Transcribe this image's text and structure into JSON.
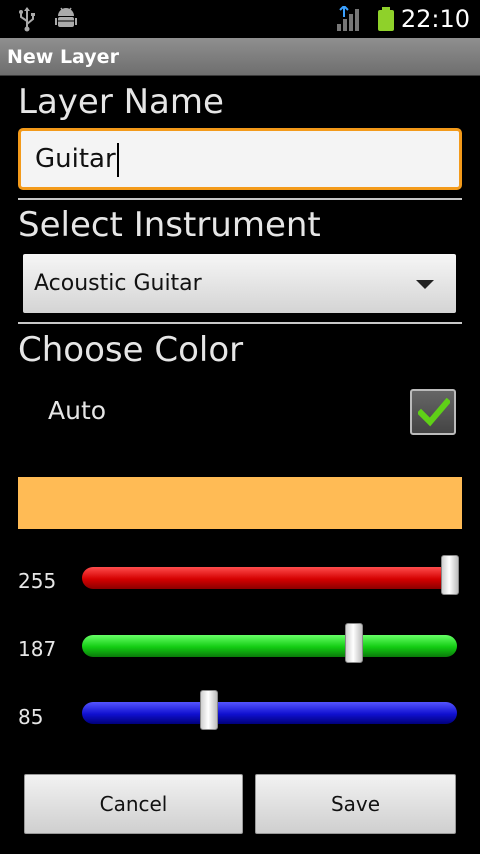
{
  "status_bar": {
    "time": "22:10",
    "icons": [
      "usb-icon",
      "android-debug-icon",
      "signal-icon",
      "battery-icon"
    ]
  },
  "dialog": {
    "title": "New Layer"
  },
  "layer_name": {
    "label": "Layer Name",
    "value": "Guitar"
  },
  "instrument": {
    "label": "Select Instrument",
    "selected": "Acoustic Guitar"
  },
  "color": {
    "label": "Choose Color",
    "auto_label": "Auto",
    "auto_checked": true,
    "swatch_hex": "#ffbb55",
    "red": {
      "label": "255",
      "value": 255,
      "max": 255
    },
    "green": {
      "label": "187",
      "value": 187,
      "max": 255
    },
    "blue": {
      "label": "85",
      "value": 85,
      "max": 255
    }
  },
  "buttons": {
    "cancel": "Cancel",
    "save": "Save"
  },
  "colors": {
    "focus_border": "#f39a1a",
    "check": "#5fd017"
  }
}
